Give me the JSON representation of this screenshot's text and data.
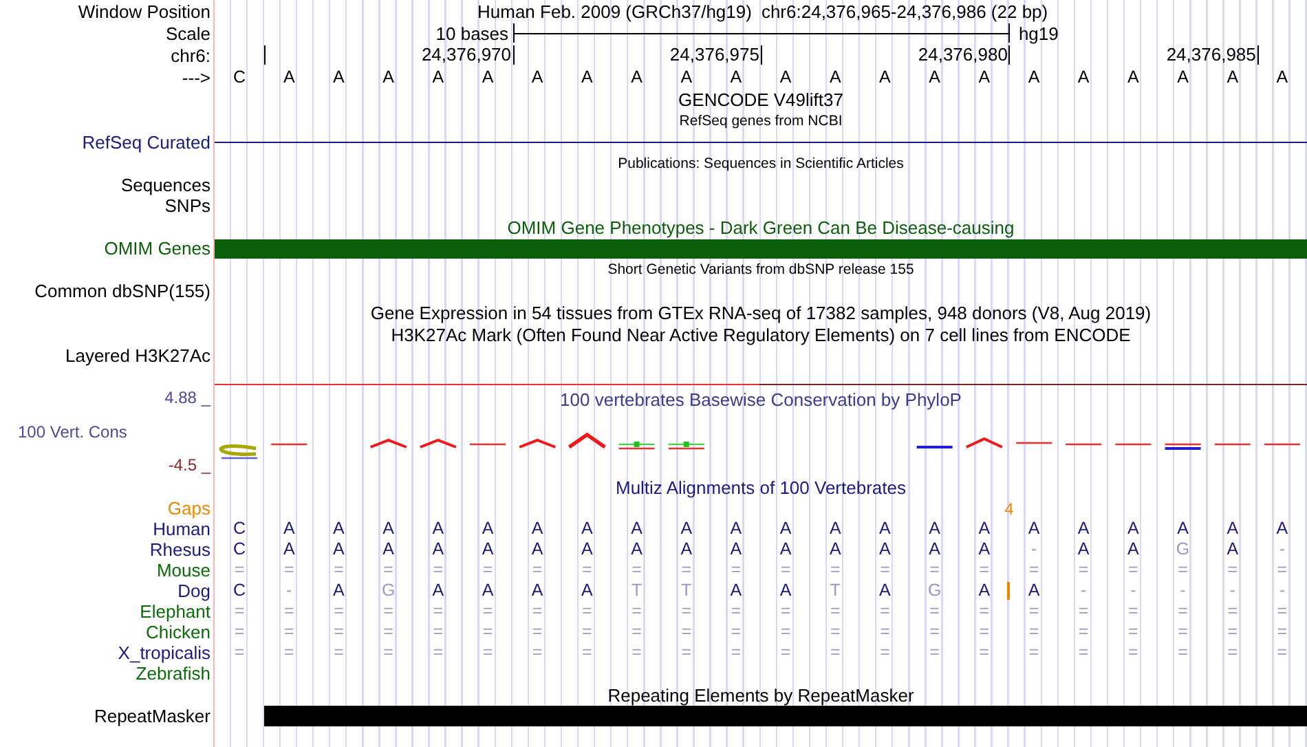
{
  "position_bar": {
    "label": "Window Position",
    "assembly": "Human Feb. 2009 (GRCh37/hg19)",
    "range": "chr6:24,376,965-24,376,986 (22 bp)"
  },
  "scale": {
    "label": "Scale",
    "length": "10 bases",
    "assembly": "hg19"
  },
  "ruler": {
    "label": "chr6:",
    "ticks": [
      "24,376,970",
      "24,376,975",
      "24,376,980",
      "24,376,985"
    ]
  },
  "sequence": {
    "label": "--->",
    "bases": [
      "C",
      "A",
      "A",
      "A",
      "A",
      "A",
      "A",
      "A",
      "A",
      "A",
      "A",
      "A",
      "A",
      "A",
      "A",
      "A",
      "A",
      "A",
      "A",
      "A",
      "A",
      "A"
    ]
  },
  "tracks": [
    {
      "kind": "caption",
      "text": "GENCODE V49lift37",
      "color": "#000000"
    },
    {
      "kind": "note",
      "text": "RefSeq genes from NCBI",
      "color": "#000000"
    },
    {
      "kind": "line",
      "label": "RefSeq Curated",
      "color": "#1a1a80"
    },
    {
      "kind": "note",
      "text": "Publications: Sequences in Scientific Articles",
      "color": "#000000"
    },
    {
      "kind": "label",
      "label": "Sequences",
      "color": "#000000"
    },
    {
      "kind": "label",
      "label": "SNPs",
      "color": "#000000"
    },
    {
      "kind": "caption",
      "text": "OMIM Gene Phenotypes - Dark Green Can Be Disease-causing",
      "color": "#0b5f0b"
    },
    {
      "kind": "bar",
      "label": "OMIM Genes",
      "color": "#0b5f0b"
    },
    {
      "kind": "note",
      "text": "Short Genetic Variants from dbSNP release 155",
      "color": "#000000"
    },
    {
      "kind": "label",
      "label": "Common dbSNP(155)",
      "color": "#000000"
    },
    {
      "kind": "caption",
      "text": "Gene Expression in 54 tissues from GTEx RNA-seq of 17382 samples, 948 donors (V8, Aug 2019)",
      "color": "#000000"
    },
    {
      "kind": "caption",
      "text": "H3K27Ac Mark (Often Found Near Active Regulatory Elements) on 7 cell lines from ENCODE",
      "color": "#000000"
    },
    {
      "kind": "label",
      "label": "Layered H3K27Ac",
      "color": "#000000"
    }
  ],
  "conservation": {
    "label": "100 Vert. Cons",
    "max": "4.88 _",
    "min": "-4.5 _",
    "title": "100 vertebrates Basewise Conservation by PhyloP"
  },
  "alignment": {
    "title": "Multiz Alignments of 100 Vertebrates",
    "gaps": {
      "label": "Gaps",
      "count": "4"
    },
    "species": [
      {
        "name": "Human",
        "color": "#1a1a80",
        "cells": [
          {
            "base": "C",
            "match": true
          },
          {
            "base": "A",
            "match": true
          },
          {
            "base": "A",
            "match": true
          },
          {
            "base": "A",
            "match": true
          },
          {
            "base": "A",
            "match": true
          },
          {
            "base": "A",
            "match": true
          },
          {
            "base": "A",
            "match": true
          },
          {
            "base": "A",
            "match": true
          },
          {
            "base": "A",
            "match": true
          },
          {
            "base": "A",
            "match": true
          },
          {
            "base": "A",
            "match": true
          },
          {
            "base": "A",
            "match": true
          },
          {
            "base": "A",
            "match": true
          },
          {
            "base": "A",
            "match": true
          },
          {
            "base": "A",
            "match": true
          },
          {
            "base": "A",
            "match": true
          },
          {
            "base": "A",
            "match": true
          },
          {
            "base": "A",
            "match": true
          },
          {
            "base": "A",
            "match": true
          },
          {
            "base": "A",
            "match": true
          },
          {
            "base": "A",
            "match": true
          },
          {
            "base": "A",
            "match": true
          }
        ]
      },
      {
        "name": "Rhesus",
        "color": "#1a1a80",
        "cells": [
          {
            "base": "C",
            "match": true
          },
          {
            "base": "A",
            "match": true
          },
          {
            "base": "A",
            "match": true
          },
          {
            "base": "A",
            "match": true
          },
          {
            "base": "A",
            "match": true
          },
          {
            "base": "A",
            "match": true
          },
          {
            "base": "A",
            "match": true
          },
          {
            "base": "A",
            "match": true
          },
          {
            "base": "A",
            "match": true
          },
          {
            "base": "A",
            "match": true
          },
          {
            "base": "A",
            "match": true
          },
          {
            "base": "A",
            "match": true
          },
          {
            "base": "A",
            "match": true
          },
          {
            "base": "A",
            "match": true
          },
          {
            "base": "A",
            "match": true
          },
          {
            "base": "A",
            "match": true
          },
          {
            "base": "-",
            "match": false
          },
          {
            "base": "A",
            "match": true
          },
          {
            "base": "A",
            "match": true
          },
          {
            "base": "G",
            "match": false
          },
          {
            "base": "A",
            "match": true
          },
          {
            "base": "-",
            "match": false
          }
        ]
      },
      {
        "name": "Mouse",
        "color": "#0b6b0b",
        "cells": [
          {
            "base": "=",
            "match": false
          },
          {
            "base": "=",
            "match": false
          },
          {
            "base": "=",
            "match": false
          },
          {
            "base": "=",
            "match": false
          },
          {
            "base": "=",
            "match": false
          },
          {
            "base": "=",
            "match": false
          },
          {
            "base": "=",
            "match": false
          },
          {
            "base": "=",
            "match": false
          },
          {
            "base": "=",
            "match": false
          },
          {
            "base": "=",
            "match": false
          },
          {
            "base": "=",
            "match": false
          },
          {
            "base": "=",
            "match": false
          },
          {
            "base": "=",
            "match": false
          },
          {
            "base": "=",
            "match": false
          },
          {
            "base": "=",
            "match": false
          },
          {
            "base": "=",
            "match": false
          },
          {
            "base": "=",
            "match": false
          },
          {
            "base": "=",
            "match": false
          },
          {
            "base": "=",
            "match": false
          },
          {
            "base": "=",
            "match": false
          },
          {
            "base": "=",
            "match": false
          },
          {
            "base": "=",
            "match": false
          }
        ]
      },
      {
        "name": "Dog",
        "color": "#1a1a80",
        "cells": [
          {
            "base": "C",
            "match": true
          },
          {
            "base": "-",
            "match": false
          },
          {
            "base": "A",
            "match": true
          },
          {
            "base": "G",
            "match": false
          },
          {
            "base": "A",
            "match": true
          },
          {
            "base": "A",
            "match": true
          },
          {
            "base": "A",
            "match": true
          },
          {
            "base": "A",
            "match": true
          },
          {
            "base": "T",
            "match": false
          },
          {
            "base": "T",
            "match": false
          },
          {
            "base": "A",
            "match": true
          },
          {
            "base": "A",
            "match": true
          },
          {
            "base": "T",
            "match": false
          },
          {
            "base": "A",
            "match": true
          },
          {
            "base": "G",
            "match": false
          },
          {
            "base": "A",
            "match": true,
            "insertion": true
          },
          {
            "base": "A",
            "match": true
          },
          {
            "base": "-",
            "match": false
          },
          {
            "base": "-",
            "match": false
          },
          {
            "base": "-",
            "match": false
          },
          {
            "base": "-",
            "match": false
          },
          {
            "base": "-",
            "match": false
          }
        ]
      },
      {
        "name": "Elephant",
        "color": "#0b6b0b",
        "cells": [
          {
            "base": "=",
            "match": false
          },
          {
            "base": "=",
            "match": false
          },
          {
            "base": "=",
            "match": false
          },
          {
            "base": "=",
            "match": false
          },
          {
            "base": "=",
            "match": false
          },
          {
            "base": "=",
            "match": false
          },
          {
            "base": "=",
            "match": false
          },
          {
            "base": "=",
            "match": false
          },
          {
            "base": "=",
            "match": false
          },
          {
            "base": "=",
            "match": false
          },
          {
            "base": "=",
            "match": false
          },
          {
            "base": "=",
            "match": false
          },
          {
            "base": "=",
            "match": false
          },
          {
            "base": "=",
            "match": false
          },
          {
            "base": "=",
            "match": false
          },
          {
            "base": "=",
            "match": false
          },
          {
            "base": "=",
            "match": false
          },
          {
            "base": "=",
            "match": false
          },
          {
            "base": "=",
            "match": false
          },
          {
            "base": "=",
            "match": false
          },
          {
            "base": "=",
            "match": false
          },
          {
            "base": "=",
            "match": false
          }
        ]
      },
      {
        "name": "Chicken",
        "color": "#0b6b0b",
        "cells": [
          {
            "base": "=",
            "match": false
          },
          {
            "base": "=",
            "match": false
          },
          {
            "base": "=",
            "match": false
          },
          {
            "base": "=",
            "match": false
          },
          {
            "base": "=",
            "match": false
          },
          {
            "base": "=",
            "match": false
          },
          {
            "base": "=",
            "match": false
          },
          {
            "base": "=",
            "match": false
          },
          {
            "base": "=",
            "match": false
          },
          {
            "base": "=",
            "match": false
          },
          {
            "base": "=",
            "match": false
          },
          {
            "base": "=",
            "match": false
          },
          {
            "base": "=",
            "match": false
          },
          {
            "base": "=",
            "match": false
          },
          {
            "base": "=",
            "match": false
          },
          {
            "base": "=",
            "match": false
          },
          {
            "base": "=",
            "match": false
          },
          {
            "base": "=",
            "match": false
          },
          {
            "base": "=",
            "match": false
          },
          {
            "base": "=",
            "match": false
          },
          {
            "base": "=",
            "match": false
          },
          {
            "base": "=",
            "match": false
          }
        ]
      },
      {
        "name": "X_tropicalis",
        "color": "#1a1a80",
        "cells": [
          {
            "base": "=",
            "match": false
          },
          {
            "base": "=",
            "match": false
          },
          {
            "base": "=",
            "match": false
          },
          {
            "base": "=",
            "match": false
          },
          {
            "base": "=",
            "match": false
          },
          {
            "base": "=",
            "match": false
          },
          {
            "base": "=",
            "match": false
          },
          {
            "base": "=",
            "match": false
          },
          {
            "base": "=",
            "match": false
          },
          {
            "base": "=",
            "match": false
          },
          {
            "base": "=",
            "match": false
          },
          {
            "base": "=",
            "match": false
          },
          {
            "base": "=",
            "match": false
          },
          {
            "base": "=",
            "match": false
          },
          {
            "base": "=",
            "match": false
          },
          {
            "base": "=",
            "match": false
          },
          {
            "base": "=",
            "match": false
          },
          {
            "base": "=",
            "match": false
          },
          {
            "base": "=",
            "match": false
          },
          {
            "base": "=",
            "match": false
          },
          {
            "base": "=",
            "match": false
          },
          {
            "base": "=",
            "match": false
          }
        ]
      },
      {
        "name": "Zebrafish",
        "color": "#0b6b0b"
      }
    ]
  },
  "repeats": {
    "title": "Repeating Elements by RepeatMasker",
    "label": "RepeatMasker"
  }
}
